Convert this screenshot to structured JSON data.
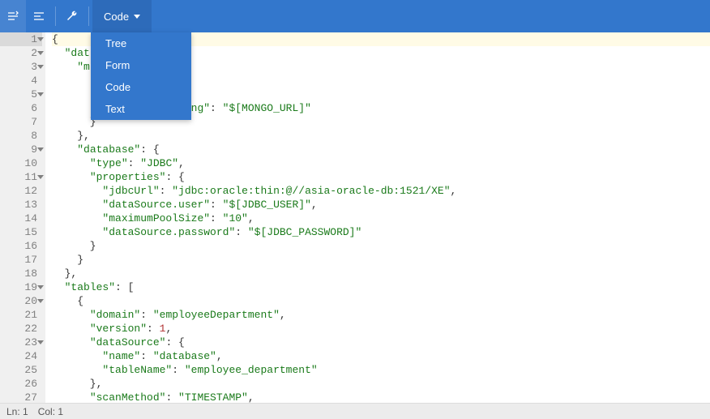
{
  "toolbar": {
    "mode_label": "Code",
    "icons": {
      "expand": "expand-icon",
      "collapse": "collapse-icon",
      "settings": "wrench-icon"
    },
    "dropdown": [
      "Tree",
      "Form",
      "Code",
      "Text"
    ]
  },
  "status": {
    "line_label": "Ln:",
    "line": "1",
    "col_label": "Col:",
    "col": "1"
  },
  "code_lines": [
    {
      "n": 1,
      "fold": true,
      "hl": true,
      "tokens": [
        [
          "p",
          "{"
        ]
      ]
    },
    {
      "n": 2,
      "fold": true,
      "tokens": [
        [
          "p",
          "  "
        ],
        [
          "k",
          "\"dat"
        ]
      ]
    },
    {
      "n": 3,
      "fold": true,
      "tokens": [
        [
          "p",
          "    "
        ],
        [
          "k",
          "\"m"
        ]
      ]
    },
    {
      "n": 4,
      "tokens": [
        [
          "p",
          ""
        ]
      ]
    },
    {
      "n": 5,
      "fold": true,
      "tokens": [
        [
          "p",
          ""
        ]
      ]
    },
    {
      "n": 6,
      "tokens": [
        [
          "p",
          "        "
        ],
        [
          "k",
          "connectionString\""
        ],
        [
          "p",
          ": "
        ],
        [
          "s",
          "\"$[MONGO_URL]\""
        ]
      ]
    },
    {
      "n": 7,
      "tokens": [
        [
          "p",
          "      }"
        ]
      ]
    },
    {
      "n": 8,
      "tokens": [
        [
          "p",
          "    },"
        ]
      ]
    },
    {
      "n": 9,
      "fold": true,
      "tokens": [
        [
          "p",
          "    "
        ],
        [
          "k",
          "\"database\""
        ],
        [
          "p",
          ": {"
        ]
      ]
    },
    {
      "n": 10,
      "tokens": [
        [
          "p",
          "      "
        ],
        [
          "k",
          "\"type\""
        ],
        [
          "p",
          ": "
        ],
        [
          "s",
          "\"JDBC\""
        ],
        [
          "p",
          ","
        ]
      ]
    },
    {
      "n": 11,
      "fold": true,
      "tokens": [
        [
          "p",
          "      "
        ],
        [
          "k",
          "\"properties\""
        ],
        [
          "p",
          ": {"
        ]
      ]
    },
    {
      "n": 12,
      "tokens": [
        [
          "p",
          "        "
        ],
        [
          "k",
          "\"jdbcUrl\""
        ],
        [
          "p",
          ": "
        ],
        [
          "s",
          "\"jdbc:oracle:thin:@//asia-oracle-db:1521/XE\""
        ],
        [
          "p",
          ","
        ]
      ]
    },
    {
      "n": 13,
      "tokens": [
        [
          "p",
          "        "
        ],
        [
          "k",
          "\"dataSource.user\""
        ],
        [
          "p",
          ": "
        ],
        [
          "s",
          "\"$[JDBC_USER]\""
        ],
        [
          "p",
          ","
        ]
      ]
    },
    {
      "n": 14,
      "tokens": [
        [
          "p",
          "        "
        ],
        [
          "k",
          "\"maximumPoolSize\""
        ],
        [
          "p",
          ": "
        ],
        [
          "s",
          "\"10\""
        ],
        [
          "p",
          ","
        ]
      ]
    },
    {
      "n": 15,
      "tokens": [
        [
          "p",
          "        "
        ],
        [
          "k",
          "\"dataSource.password\""
        ],
        [
          "p",
          ": "
        ],
        [
          "s",
          "\"$[JDBC_PASSWORD]\""
        ]
      ]
    },
    {
      "n": 16,
      "tokens": [
        [
          "p",
          "      }"
        ]
      ]
    },
    {
      "n": 17,
      "tokens": [
        [
          "p",
          "    }"
        ]
      ]
    },
    {
      "n": 18,
      "tokens": [
        [
          "p",
          "  },"
        ]
      ]
    },
    {
      "n": 19,
      "fold": true,
      "tokens": [
        [
          "p",
          "  "
        ],
        [
          "k",
          "\"tables\""
        ],
        [
          "p",
          ": ["
        ]
      ]
    },
    {
      "n": 20,
      "fold": true,
      "tokens": [
        [
          "p",
          "    {"
        ]
      ]
    },
    {
      "n": 21,
      "tokens": [
        [
          "p",
          "      "
        ],
        [
          "k",
          "\"domain\""
        ],
        [
          "p",
          ": "
        ],
        [
          "s",
          "\"employeeDepartment\""
        ],
        [
          "p",
          ","
        ]
      ]
    },
    {
      "n": 22,
      "tokens": [
        [
          "p",
          "      "
        ],
        [
          "k",
          "\"version\""
        ],
        [
          "p",
          ": "
        ],
        [
          "n",
          "1"
        ],
        [
          "p",
          ","
        ]
      ]
    },
    {
      "n": 23,
      "fold": true,
      "tokens": [
        [
          "p",
          "      "
        ],
        [
          "k",
          "\"dataSource\""
        ],
        [
          "p",
          ": {"
        ]
      ]
    },
    {
      "n": 24,
      "tokens": [
        [
          "p",
          "        "
        ],
        [
          "k",
          "\"name\""
        ],
        [
          "p",
          ": "
        ],
        [
          "s",
          "\"database\""
        ],
        [
          "p",
          ","
        ]
      ]
    },
    {
      "n": 25,
      "tokens": [
        [
          "p",
          "        "
        ],
        [
          "k",
          "\"tableName\""
        ],
        [
          "p",
          ": "
        ],
        [
          "s",
          "\"employee_department\""
        ]
      ]
    },
    {
      "n": 26,
      "tokens": [
        [
          "p",
          "      },"
        ]
      ]
    },
    {
      "n": 27,
      "tokens": [
        [
          "p",
          "      "
        ],
        [
          "k",
          "\"scanMethod\""
        ],
        [
          "p",
          ": "
        ],
        [
          "s",
          "\"TIMESTAMP\""
        ],
        [
          "p",
          ","
        ]
      ]
    }
  ]
}
